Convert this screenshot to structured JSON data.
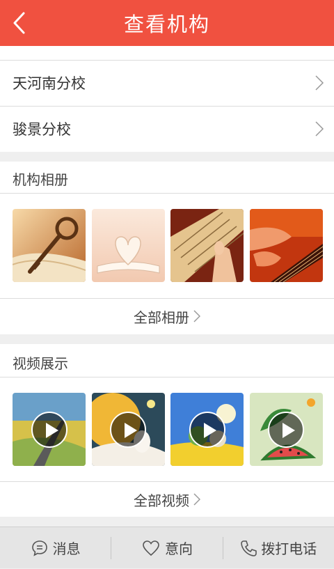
{
  "header": {
    "title": "查看机构",
    "back_icon": "chevron-left-icon"
  },
  "branches": [
    {
      "name": "天河南分校"
    },
    {
      "name": "骏景分校"
    }
  ],
  "album": {
    "title": "机构相册",
    "photos": [
      "key-on-book",
      "heart-book-pages",
      "guitar-fingers",
      "guitar-hand-red"
    ],
    "more_label": "全部相册"
  },
  "video": {
    "title": "视频展示",
    "videos": [
      "cartoon-field",
      "cartoon-rabbit-planet",
      "cartoon-blue-sky",
      "cartoon-watermelon"
    ],
    "more_label": "全部视频"
  },
  "bottom_bar": {
    "message_label": "消息",
    "intent_label": "意向",
    "call_label": "拨打电话"
  },
  "colors": {
    "accent": "#f05140",
    "background": "#efefef"
  }
}
